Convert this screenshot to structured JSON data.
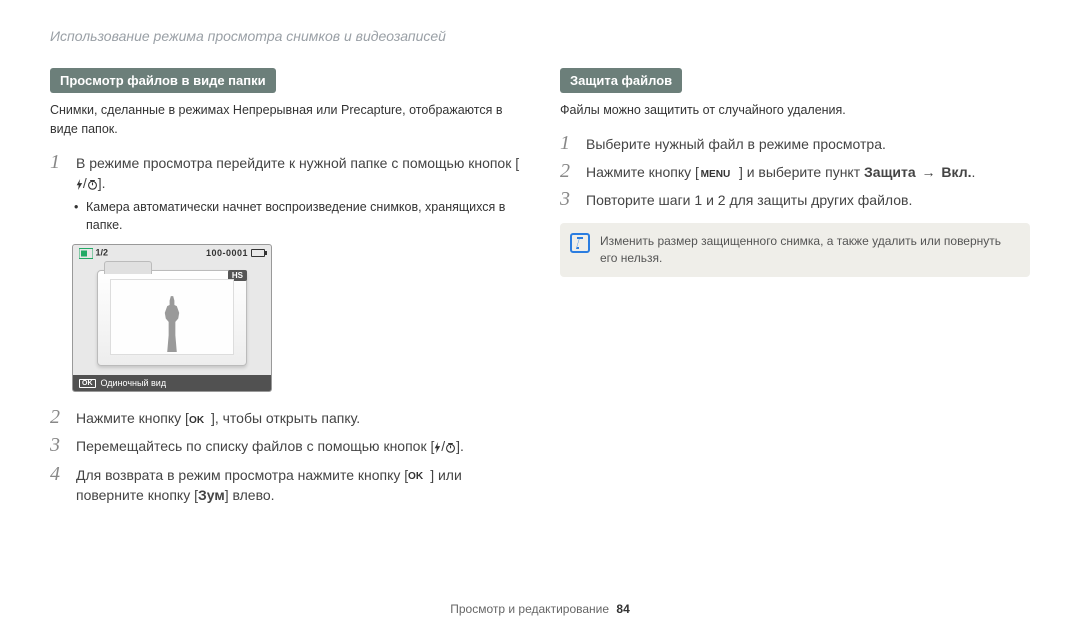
{
  "page_title": "Использование режима просмотра снимков и видеозаписей",
  "left": {
    "header": "Просмотр файлов в виде папки",
    "intro": "Снимки, сделанные в режимах Непрерывная или Precapture, отображаются в виде папок.",
    "step1_a": "В режиме просмотра перейдите к нужной папке с помощью кнопок [",
    "step1_b": "].",
    "bullet": "Камера автоматически начнет воспроизведение снимков, хранящихся в папке.",
    "screen": {
      "counter": "1/2",
      "folder_id": "100-0001",
      "badge": "HS",
      "ok": "OK",
      "bottom_label": "Одиночный вид"
    },
    "step2_a": "Нажмите кнопку [",
    "step2_b": "], чтобы открыть папку.",
    "step3_a": "Перемещайтесь по списку файлов с помощью кнопок [",
    "step3_b": "].",
    "step4_a": "Для возврата в режим просмотра нажмите кнопку [",
    "step4_b": "] или поверните кнопку [",
    "step4_zoom": "Зум",
    "step4_c": "] влево."
  },
  "right": {
    "header": "Защита файлов",
    "intro": "Файлы можно защитить от случайного удаления.",
    "step1": "Выберите нужный файл в режиме просмотра.",
    "step2_a": "Нажмите кнопку [",
    "step2_b": "] и выберите пункт ",
    "step2_protect": "Защита",
    "step2_arrow": "→",
    "step2_on": "Вкл.",
    "step2_c": ".",
    "step3": "Повторите шаги 1 и 2 для защиты других файлов.",
    "note": "Изменить размер защищенного снимка, а также удалить или повернуть его нельзя."
  },
  "footer": {
    "section": "Просмотр и редактирование",
    "page": "84"
  },
  "icons": {
    "flash_timer": "flash/timer",
    "ok": "OK",
    "menu": "MENU"
  }
}
